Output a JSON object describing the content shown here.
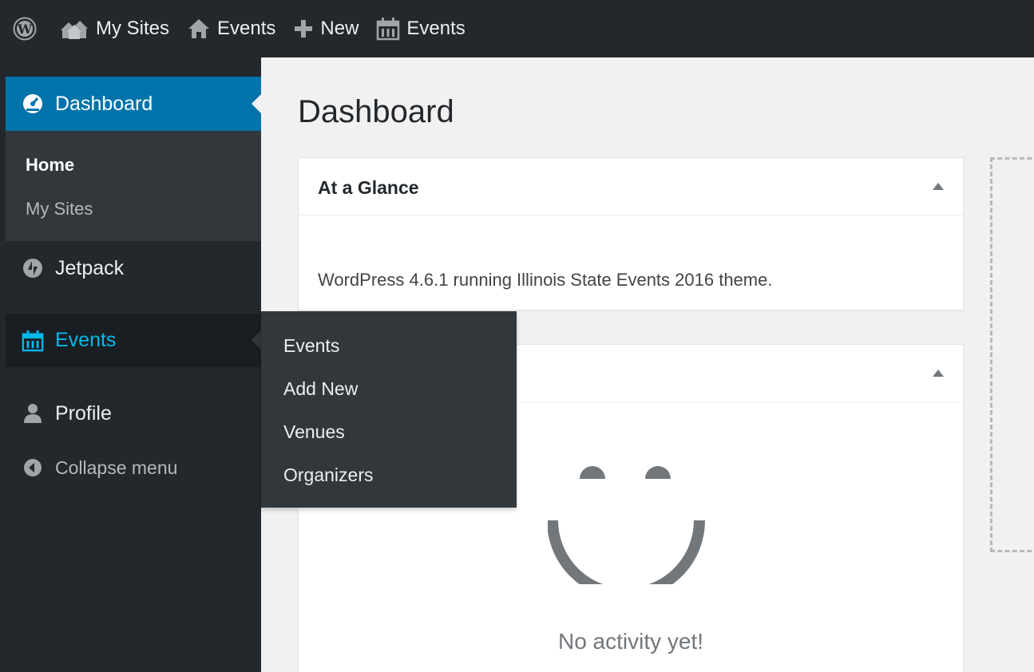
{
  "admin_bar": {
    "items": [
      {
        "name": "wordpress-logo",
        "icon": "wordpress-icon",
        "label": ""
      },
      {
        "name": "my-sites",
        "icon": "network-icon",
        "label": "My Sites"
      },
      {
        "name": "site-events",
        "icon": "home-icon",
        "label": "Events"
      },
      {
        "name": "new-content",
        "icon": "plus-icon",
        "label": "New"
      },
      {
        "name": "events-calendar",
        "icon": "calendar-icon",
        "label": "Events"
      }
    ]
  },
  "sidebar": {
    "dashboard": {
      "label": "Dashboard",
      "icon": "dashboard-icon"
    },
    "dashboard_submenu": [
      {
        "label": "Home",
        "current": true
      },
      {
        "label": "My Sites",
        "current": false
      }
    ],
    "jetpack": {
      "label": "Jetpack",
      "icon": "jetpack-icon"
    },
    "events": {
      "label": "Events",
      "icon": "calendar-icon"
    },
    "profile": {
      "label": "Profile",
      "icon": "user-icon"
    },
    "collapse": {
      "label": "Collapse menu",
      "icon": "collapse-icon"
    }
  },
  "events_flyout": {
    "items": [
      "Events",
      "Add New",
      "Venues",
      "Organizers"
    ]
  },
  "main": {
    "title": "Dashboard",
    "at_a_glance": {
      "title": "At a Glance",
      "text": "WordPress 4.6.1 running Illinois State Events 2016 theme."
    },
    "activity": {
      "title": "",
      "empty_text": "No activity yet!"
    }
  },
  "colors": {
    "admin_bar_bg": "#23282d",
    "sidebar_bg": "#23282d",
    "submenu_bg": "#32373c",
    "accent_blue": "#0073aa",
    "active_text": "#00b9eb",
    "content_bg": "#f1f1f1"
  }
}
